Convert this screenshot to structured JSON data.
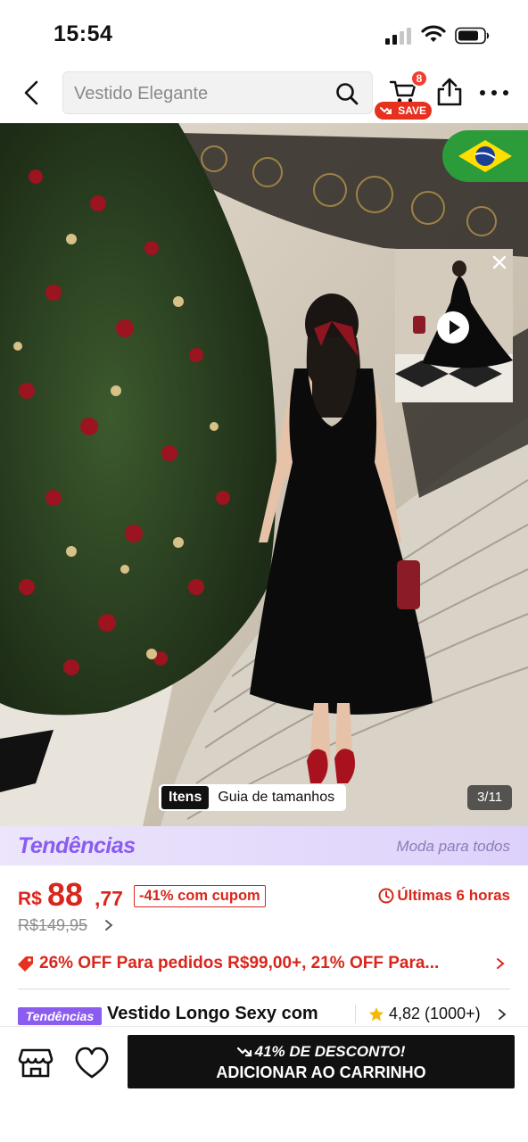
{
  "status_bar": {
    "time": "15:54"
  },
  "search": {
    "query": "Vestido Elegante"
  },
  "cart": {
    "badge_count": "8",
    "save_label": "SAVE"
  },
  "gallery": {
    "tab_items": "Itens",
    "tab_size_guide": "Guia de tamanhos",
    "counter": "3/11",
    "flag": "brazil-flag"
  },
  "banner": {
    "logo": "Tendências",
    "tagline": "Moda para todos",
    "color": "#8a5cf0"
  },
  "price": {
    "currency": "R$",
    "integer": "88",
    "decimal": ",77",
    "discount": "-41% com cupom",
    "timer": "Últimas 6 horas",
    "original": "R$149,95",
    "accent_color": "#d9261c"
  },
  "coupon": {
    "text": "26% OFF Para pedidos R$99,00+,  21% OFF Para..."
  },
  "product": {
    "brand_badge": "Tendências",
    "title": "Vestido Longo Sexy com",
    "rating": "4,82",
    "rating_count": "(1000+)"
  },
  "cta": {
    "line1": "41% DE DESCONTO!",
    "line2": "ADICIONAR AO CARRINHO"
  }
}
